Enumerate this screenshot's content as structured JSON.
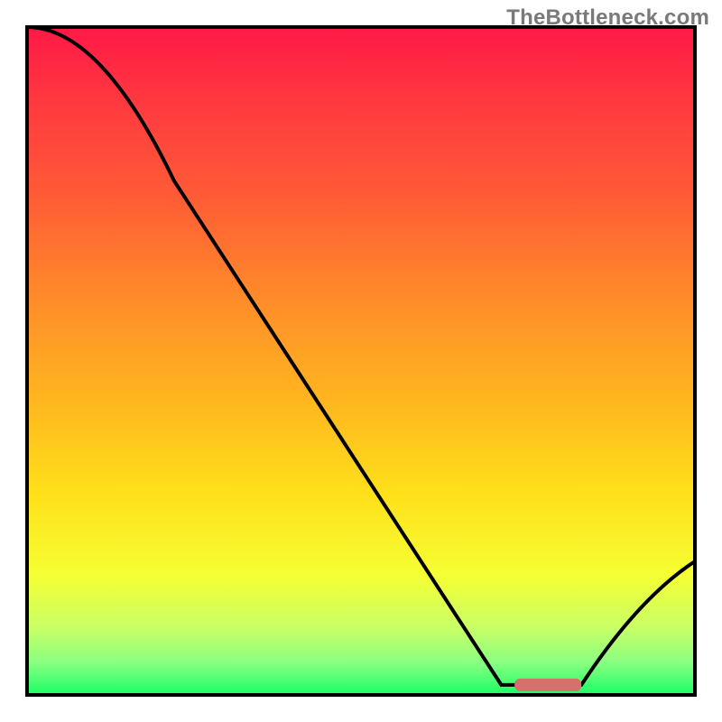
{
  "watermark": "TheBottleneck.com",
  "colors": {
    "curve": "#000000",
    "bar_fill": "#d6706c",
    "frame": "#000000",
    "gradient_stops": [
      {
        "offset": 0.0,
        "color": "#ff1947"
      },
      {
        "offset": 0.12,
        "color": "#ff3b3f"
      },
      {
        "offset": 0.25,
        "color": "#ff5a36"
      },
      {
        "offset": 0.4,
        "color": "#ff8a2a"
      },
      {
        "offset": 0.55,
        "color": "#ffb31f"
      },
      {
        "offset": 0.7,
        "color": "#ffe01a"
      },
      {
        "offset": 0.82,
        "color": "#f5ff33"
      },
      {
        "offset": 0.9,
        "color": "#c8ff66"
      },
      {
        "offset": 0.95,
        "color": "#8cff80"
      },
      {
        "offset": 1.0,
        "color": "#1aff66"
      }
    ]
  },
  "chart_data": {
    "type": "line",
    "title": "",
    "xlabel": "",
    "ylabel": "",
    "xlim": [
      0,
      100
    ],
    "ylim": [
      0,
      100
    ],
    "series": [
      {
        "name": "bottleneck-curve",
        "x": [
          0,
          22,
          71,
          77,
          83,
          100
        ],
        "values": [
          100,
          77,
          1.5,
          1.5,
          1.5,
          20
        ]
      }
    ],
    "optimal_bar": {
      "x_start": 73,
      "x_end": 83,
      "y": 1.5
    }
  }
}
